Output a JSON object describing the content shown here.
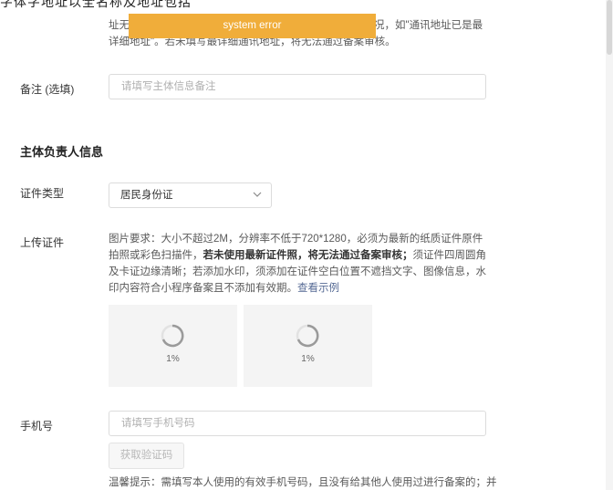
{
  "topstrip_text": "字体字地址以全名称及地址包括",
  "address_note": {
    "part1": "址无",
    "part2": "况，如\"通讯地址已是最详细地址\"。若未填写最详细通讯地址，将无法通过备案审核。"
  },
  "toast": {
    "message": "system error"
  },
  "remark": {
    "label": "备注 (选填)",
    "placeholder": "请填写主体信息备注"
  },
  "section_title": "主体负责人信息",
  "cert_type": {
    "label": "证件类型",
    "value": "居民身份证"
  },
  "upload": {
    "label": "上传证件",
    "req_plain1": "图片要求：大小不超过2M，分辨率不低于720*1280，必须为最新的纸质证件原件拍照或彩色扫描件，",
    "req_bold": "若未使用最新证件照，将无法通过备案审核；",
    "req_plain2": "须证件四周圆角及卡证边缘清晰；若添加水印，须添加在证件空白位置不遮挡文字、图像信息，水印内容符合小程序备案且不添加有效期。",
    "example_link": "查看示例",
    "slots": [
      {
        "progress": "1%"
      },
      {
        "progress": "1%"
      }
    ]
  },
  "phone": {
    "label": "手机号",
    "placeholder": "请填写手机号码",
    "send_code_button": "获取验证码",
    "tip": "温馨提示：需填写本人使用的有效手机号码，且没有给其他人使用过进行备案的；并"
  },
  "colors": {
    "toast": "#f0ad3a",
    "link": "#576b95"
  }
}
